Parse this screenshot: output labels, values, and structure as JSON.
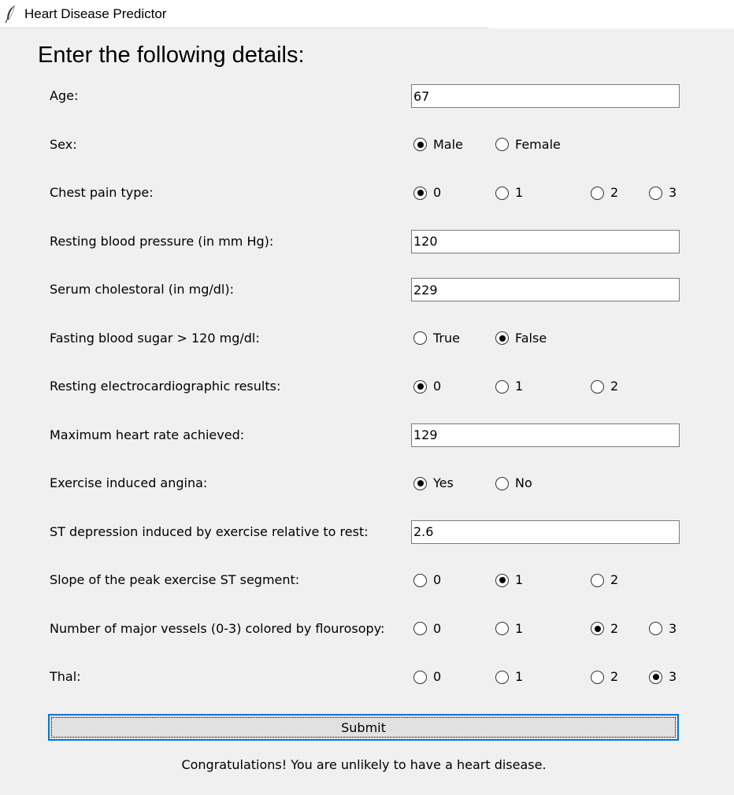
{
  "window": {
    "title": "Heart Disease Predictor",
    "icon": "feather-icon"
  },
  "form": {
    "heading": "Enter the following details:",
    "fields": [
      {
        "label": "Age:",
        "type": "entry",
        "value": "67"
      },
      {
        "label": "Sex:",
        "type": "radio",
        "options": [
          "Male",
          "Female"
        ],
        "selected": "Male"
      },
      {
        "label": "Chest pain type:",
        "type": "radio",
        "options": [
          "0",
          "1",
          "2",
          "3"
        ],
        "selected": "0"
      },
      {
        "label": "Resting blood pressure (in mm Hg):",
        "type": "entry",
        "value": "120"
      },
      {
        "label": "Serum cholestoral (in mg/dl):",
        "type": "entry",
        "value": "229"
      },
      {
        "label": "Fasting blood sugar > 120 mg/dl:",
        "type": "radio",
        "options": [
          "True",
          "False"
        ],
        "selected": "False"
      },
      {
        "label": "Resting electrocardiographic results:",
        "type": "radio",
        "options": [
          "0",
          "1",
          "2"
        ],
        "selected": "0"
      },
      {
        "label": "Maximum heart rate achieved:",
        "type": "entry",
        "value": "129"
      },
      {
        "label": "Exercise induced angina:",
        "type": "radio",
        "options": [
          "Yes",
          "No"
        ],
        "selected": "Yes"
      },
      {
        "label": "ST depression induced by exercise relative to rest:",
        "type": "entry",
        "value": "2.6"
      },
      {
        "label": "Slope of the peak exercise ST segment:",
        "type": "radio",
        "options": [
          "0",
          "1",
          "2"
        ],
        "selected": "1"
      },
      {
        "label": "Number of major vessels (0-3) colored by flourosopy:",
        "type": "radio",
        "options": [
          "0",
          "1",
          "2",
          "3"
        ],
        "selected": "2"
      },
      {
        "label": "Thal:",
        "type": "radio",
        "options": [
          "0",
          "1",
          "2",
          "3"
        ],
        "selected": "3"
      }
    ],
    "submit_label": "Submit",
    "result": "Congratulations! You are unlikely to have a heart disease."
  }
}
